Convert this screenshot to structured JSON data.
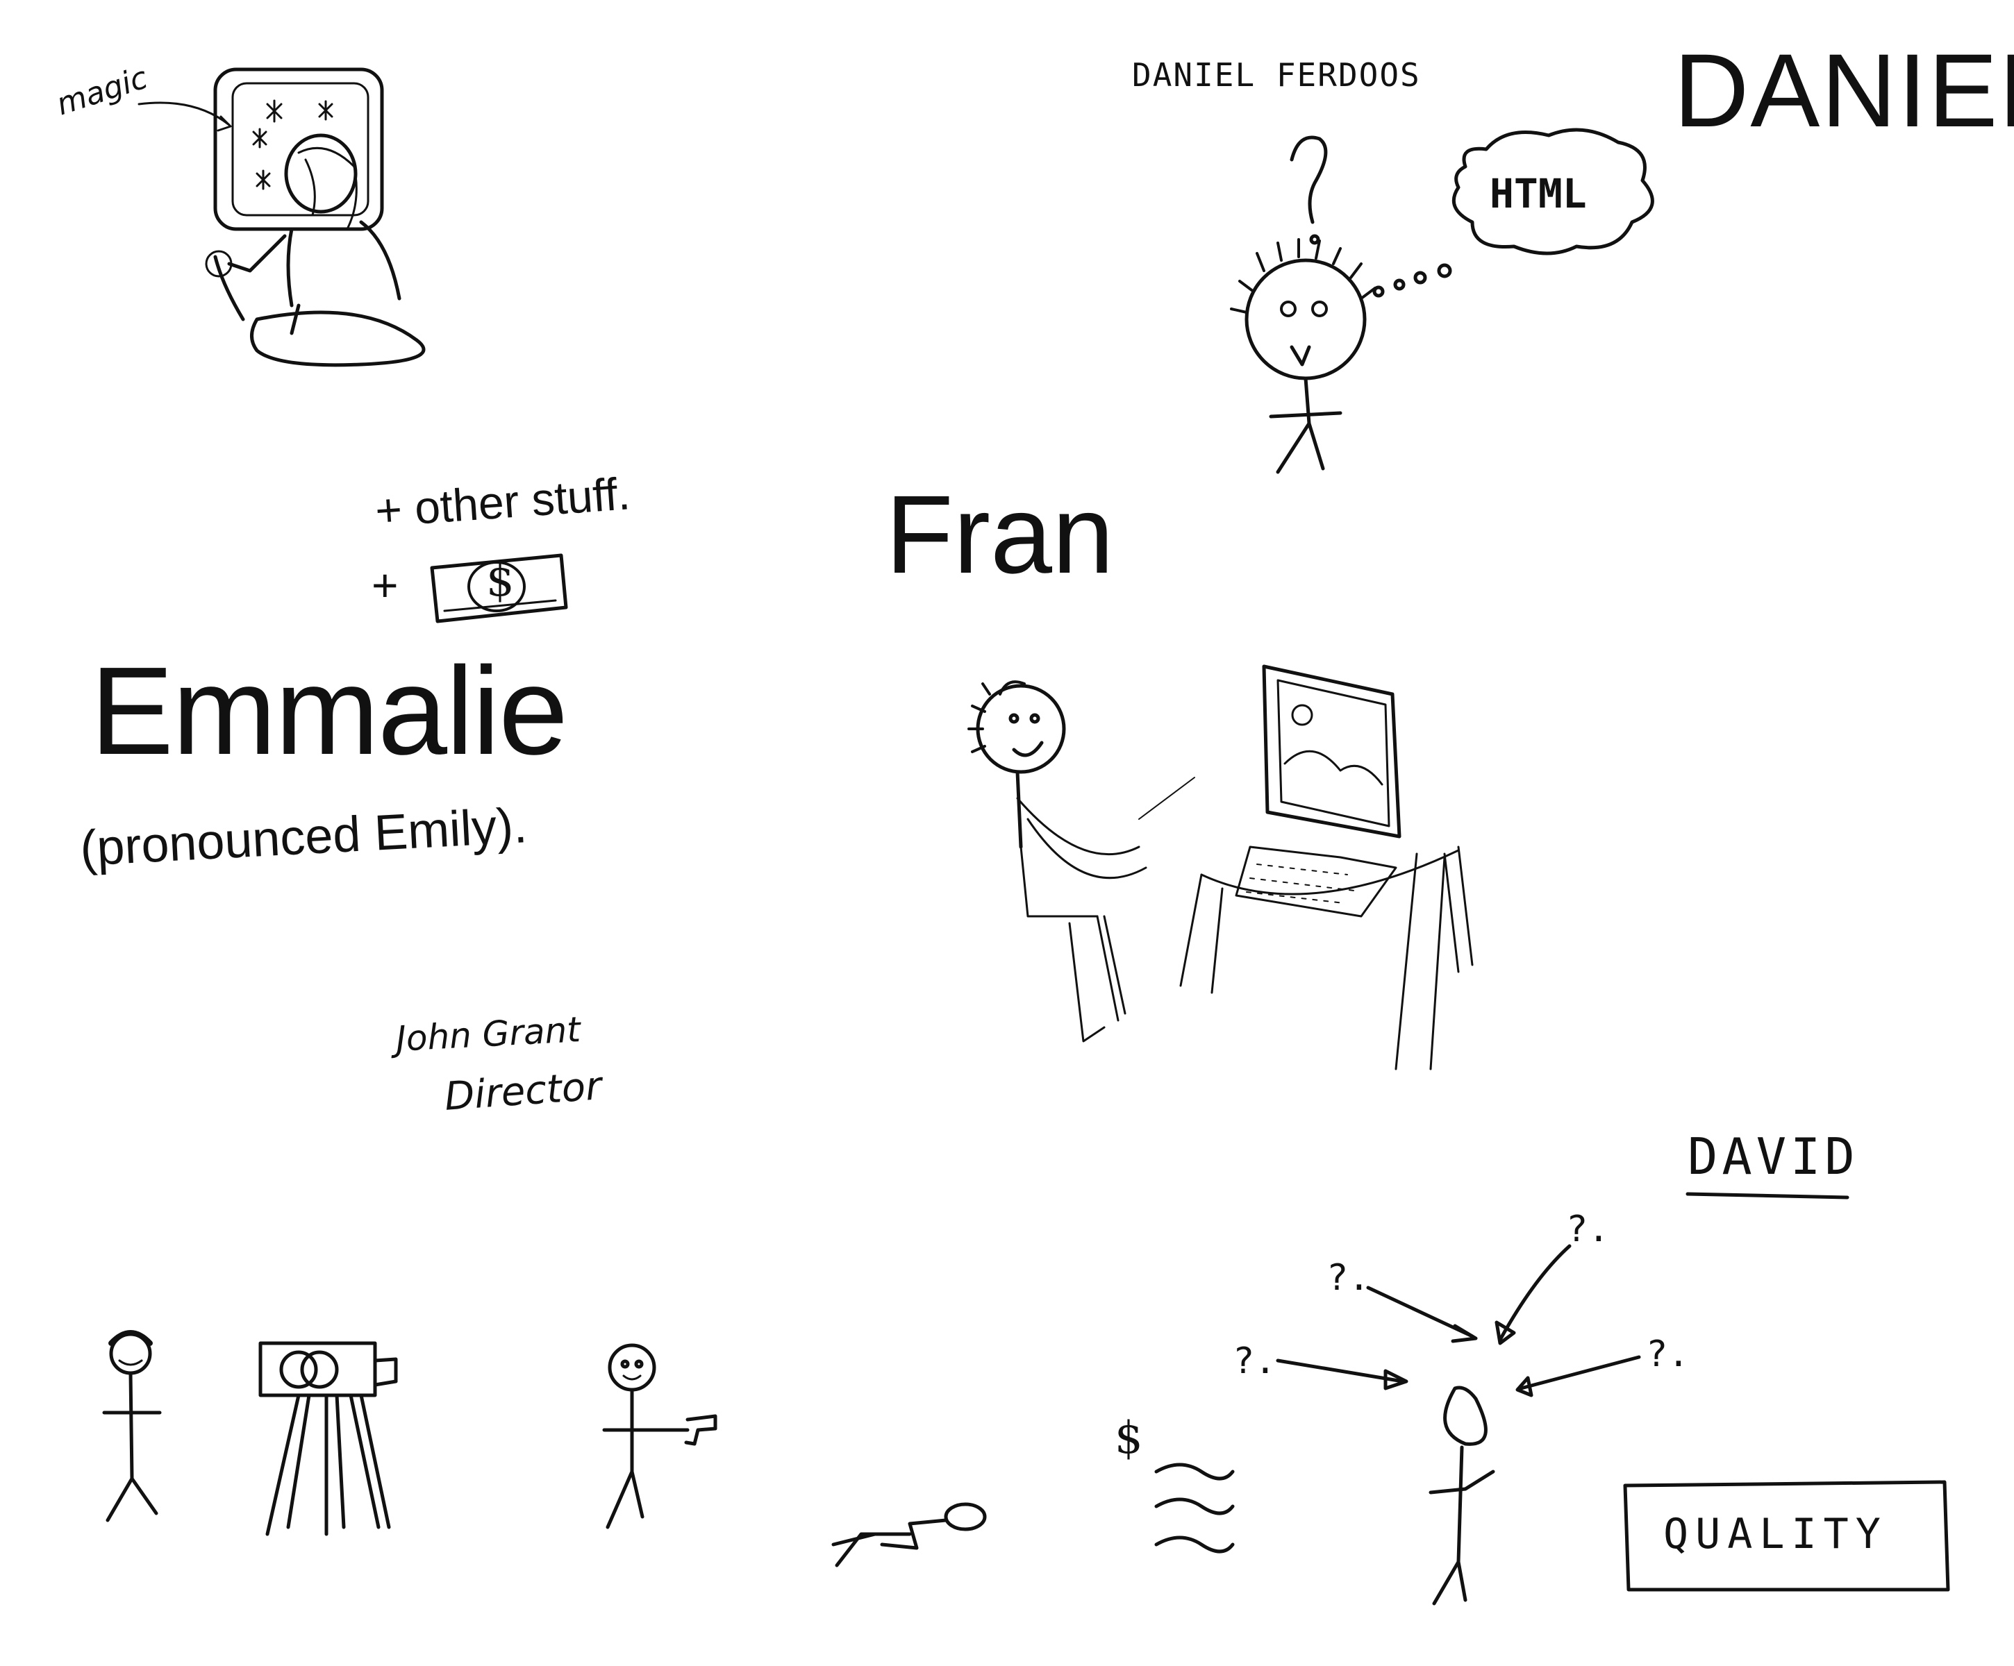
{
  "labels": {
    "magic": "magic",
    "daniel_full": "DANIEL FERDOOS",
    "daniel_big": "DANIEL",
    "html_bubble": "HTML",
    "other_stuff": "+ other stuff.",
    "plus": "+",
    "dollar_bill": "$",
    "fran": "Fran",
    "emmalie": "Emmalie",
    "pronounced": "(pronounced Emily).",
    "john_name": "John Grant",
    "john_role": "Director",
    "david": "DAVID",
    "quality": "QUALITY",
    "dollar_sign": "$",
    "question_mark": "?",
    "question_1": "?.",
    "question_2": "?.",
    "question_3": "?.",
    "question_4": "?."
  },
  "colors": {
    "ink": "#111111",
    "paper": "#ffffff"
  }
}
